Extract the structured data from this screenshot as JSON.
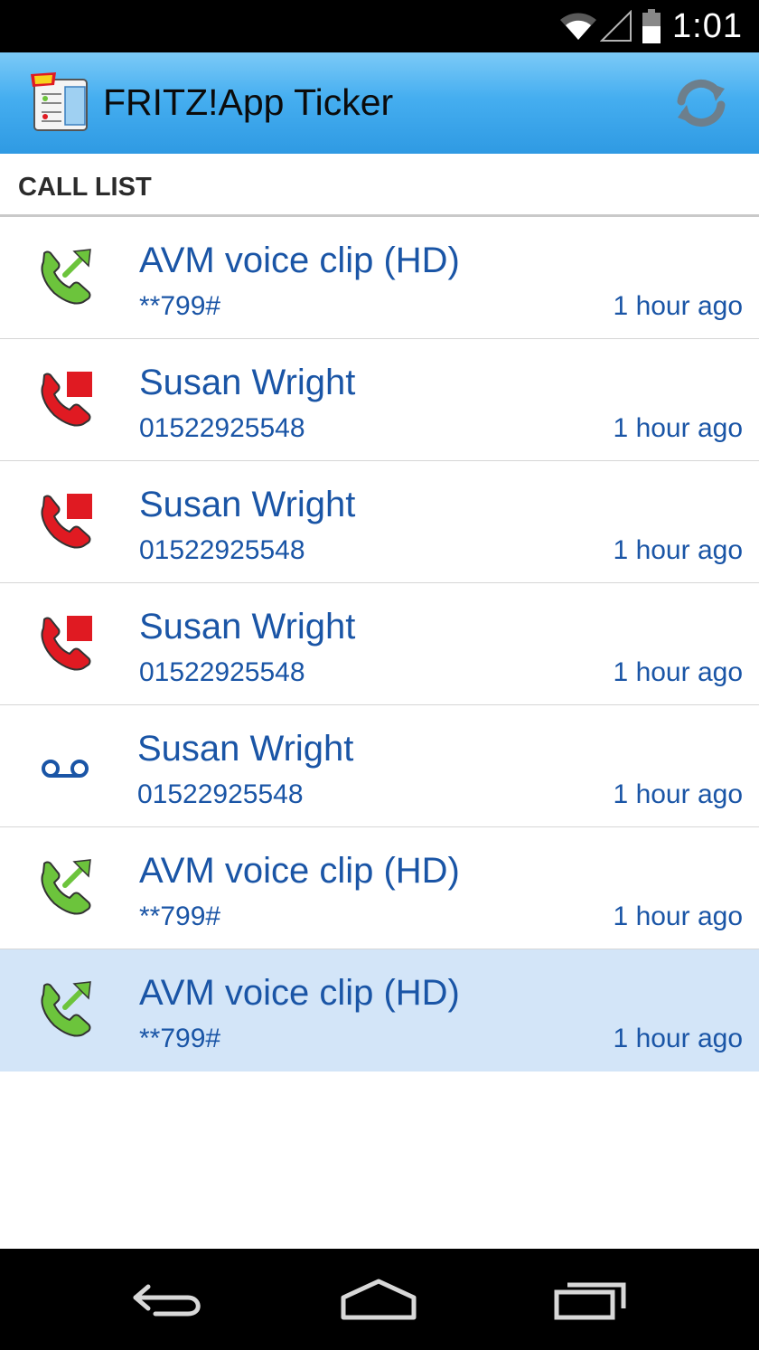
{
  "status_bar": {
    "time": "1:01",
    "icons": [
      "wifi-icon",
      "cell-signal-icon",
      "battery-icon"
    ]
  },
  "action_bar": {
    "title": "FRITZ!App Ticker",
    "logo_icon": "fritz-app-logo-icon",
    "refresh_icon": "refresh-icon"
  },
  "section": {
    "title": "CALL LIST"
  },
  "calls": [
    {
      "type": "outgoing",
      "icon": "outgoing-call-icon",
      "name": "AVM voice clip (HD)",
      "number": "**799#",
      "time": "1 hour ago",
      "selected": false
    },
    {
      "type": "missed",
      "icon": "missed-call-icon",
      "name": "Susan Wright",
      "number": "01522925548",
      "time": "1 hour ago",
      "selected": false
    },
    {
      "type": "missed",
      "icon": "missed-call-icon",
      "name": "Susan Wright",
      "number": "01522925548",
      "time": "1 hour ago",
      "selected": false
    },
    {
      "type": "missed",
      "icon": "missed-call-icon",
      "name": "Susan Wright",
      "number": "01522925548",
      "time": "1 hour ago",
      "selected": false
    },
    {
      "type": "voicemail",
      "icon": "voicemail-icon",
      "name": "Susan Wright",
      "number": "01522925548",
      "time": "1 hour ago",
      "selected": false
    },
    {
      "type": "outgoing",
      "icon": "outgoing-call-icon",
      "name": "AVM voice clip (HD)",
      "number": "**799#",
      "time": "1 hour ago",
      "selected": false
    },
    {
      "type": "outgoing",
      "icon": "outgoing-call-icon",
      "name": "AVM voice clip (HD)",
      "number": "**799#",
      "time": "1 hour ago",
      "selected": true
    }
  ],
  "colors": {
    "accent_text": "#1a55a6",
    "action_bar": "#45aef0",
    "selected_row": "#d3e5f8",
    "outgoing": "#6cc43c",
    "missed": "#e01a22",
    "voicemail": "#1a55a6"
  },
  "nav_bar": {
    "icons": [
      "back-icon",
      "home-icon",
      "recent-apps-icon"
    ]
  }
}
